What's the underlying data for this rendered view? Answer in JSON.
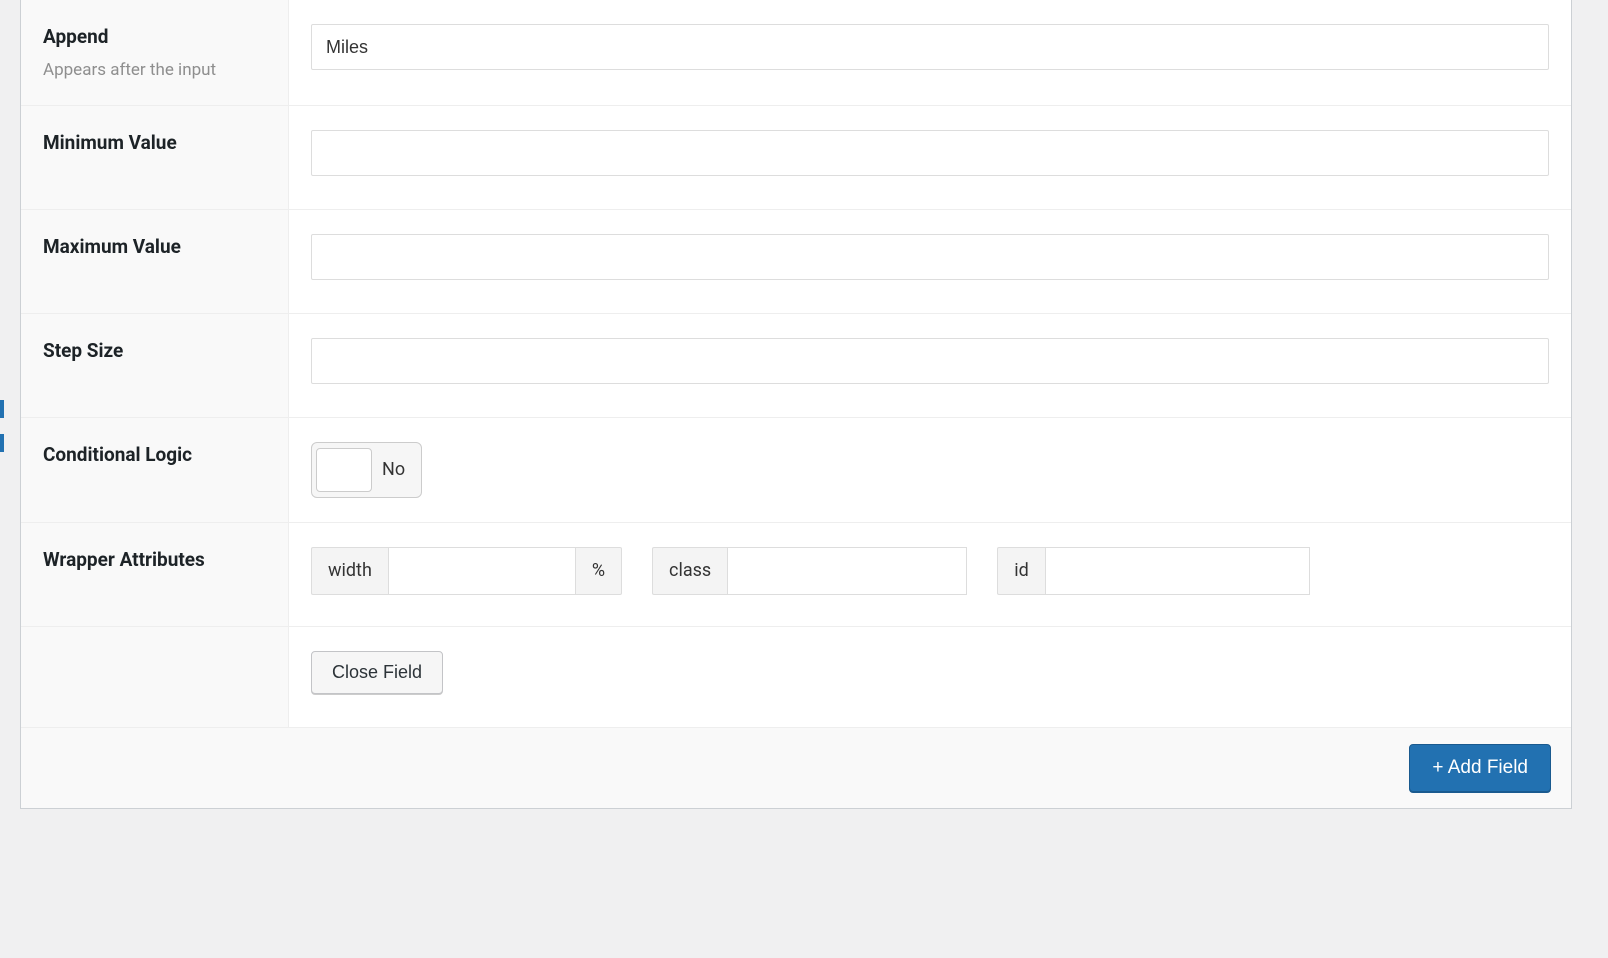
{
  "rows": {
    "append": {
      "label": "Append",
      "desc": "Appears after the input",
      "value": "Miles"
    },
    "min": {
      "label": "Minimum Value",
      "value": ""
    },
    "max": {
      "label": "Maximum Value",
      "value": ""
    },
    "step": {
      "label": "Step Size",
      "value": ""
    },
    "cond": {
      "label": "Conditional Logic",
      "state": "No"
    },
    "wrap": {
      "label": "Wrapper Attributes",
      "width_label": "width",
      "width_unit": "%",
      "width_value": "",
      "class_label": "class",
      "class_value": "",
      "id_label": "id",
      "id_value": ""
    }
  },
  "buttons": {
    "close_field": "Close Field",
    "add_field": "+ Add Field"
  }
}
